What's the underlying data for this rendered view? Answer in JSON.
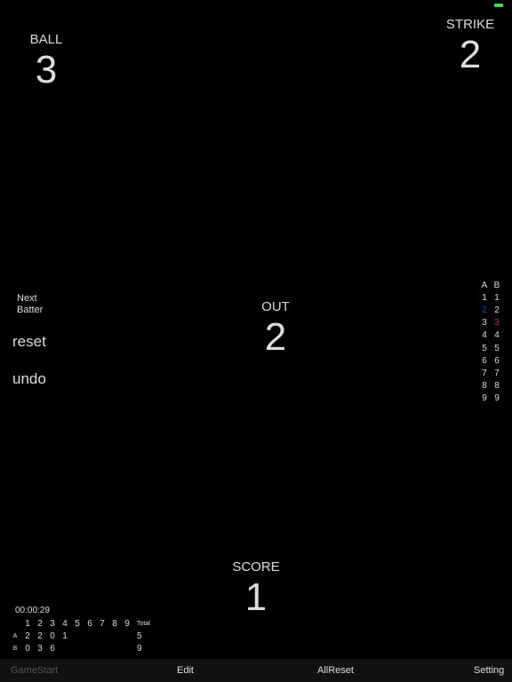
{
  "colors": {
    "background": "#000000",
    "text": "#dddddd",
    "toolbar_bg": "#111111",
    "disabled": "#555555",
    "current_a": "#2b3dd6",
    "current_b": "#d62020",
    "battery": "#3ddc5b"
  },
  "icons": {
    "status": "battery-icon"
  },
  "counters": {
    "ball": {
      "label": "BALL",
      "value": "3"
    },
    "strike": {
      "label": "STRIKE",
      "value": "2"
    },
    "out": {
      "label": "OUT",
      "value": "2"
    },
    "score": {
      "label": "SCORE",
      "value": "1"
    }
  },
  "controls": {
    "next_batter": [
      "Next",
      "Batter"
    ],
    "reset": "reset",
    "undo": "undo"
  },
  "lineup": {
    "headers": [
      "A",
      "B"
    ],
    "rows": [
      [
        "1",
        "1"
      ],
      [
        "2",
        "2"
      ],
      [
        "3",
        "3"
      ],
      [
        "4",
        "4"
      ],
      [
        "5",
        "5"
      ],
      [
        "6",
        "6"
      ],
      [
        "7",
        "7"
      ],
      [
        "8",
        "8"
      ],
      [
        "9",
        "9"
      ]
    ],
    "current_a": "2",
    "current_b": "3"
  },
  "timer": "00:00:29",
  "scoreboard": {
    "innings": [
      "1",
      "2",
      "3",
      "4",
      "5",
      "6",
      "7",
      "8",
      "9"
    ],
    "total_label": "Total",
    "teams": [
      {
        "name": "A",
        "runs": [
          "2",
          "2",
          "0",
          "1",
          "",
          "",
          "",
          "",
          ""
        ],
        "total": "5"
      },
      {
        "name": "B",
        "runs": [
          "0",
          "3",
          "6",
          "",
          "",
          "",
          "",
          "",
          ""
        ],
        "total": "9"
      }
    ]
  },
  "toolbar": {
    "game_start": "GameStart",
    "edit": "Edit",
    "all_reset": "AllReset",
    "setting": "Setting"
  }
}
